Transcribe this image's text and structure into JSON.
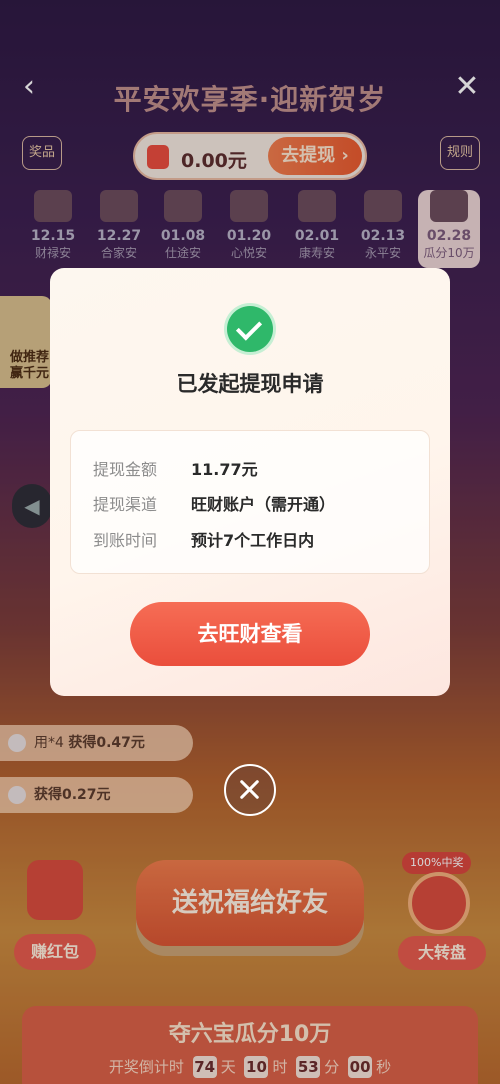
{
  "header": {
    "title": "平安欢享季·迎新贺岁",
    "back_icon": "‹",
    "close_icon": "✕",
    "prize_label": "奖品",
    "rule_label": "规则"
  },
  "balance": {
    "amount": "0.00元",
    "withdraw_label": "去提现",
    "withdraw_arrow": "›"
  },
  "schedule": [
    {
      "date": "12.15",
      "title": "财禄安"
    },
    {
      "date": "12.27",
      "title": "合家安"
    },
    {
      "date": "01.08",
      "title": "仕途安"
    },
    {
      "date": "01.20",
      "title": "心悦安"
    },
    {
      "date": "02.01",
      "title": "康寿安"
    },
    {
      "date": "02.13",
      "title": "永平安"
    },
    {
      "date": "02.28",
      "title": "瓜分10万"
    }
  ],
  "side_card": {
    "line1": "做推荐",
    "line2": "赢千元"
  },
  "left_arrow_icon": "◀",
  "feed": [
    {
      "user": "用*4",
      "text": "获得0.47元"
    },
    {
      "user": "",
      "text": "获得0.27元"
    }
  ],
  "bottom": {
    "earn_label": "赚红包",
    "send_label": "送祝福给好友",
    "wheel_tag": "100%中奖",
    "wheel_label": "大转盘",
    "lottery_title": "夺六宝瓜分10万",
    "countdown_prefix": "开奖倒计时",
    "countdown": [
      {
        "n": "74",
        "u": "天"
      },
      {
        "n": "10",
        "u": "时"
      },
      {
        "n": "53",
        "u": "分"
      },
      {
        "n": "00",
        "u": "秒"
      }
    ]
  },
  "modal": {
    "title": "已发起提现申请",
    "rows": [
      {
        "key": "提现金额",
        "value": "11.77元"
      },
      {
        "key": "提现渠道",
        "value": "旺财账户（需开通）"
      },
      {
        "key": "到账时间",
        "value": "预计7个工作日内"
      }
    ],
    "button_label": "去旺财查看"
  }
}
